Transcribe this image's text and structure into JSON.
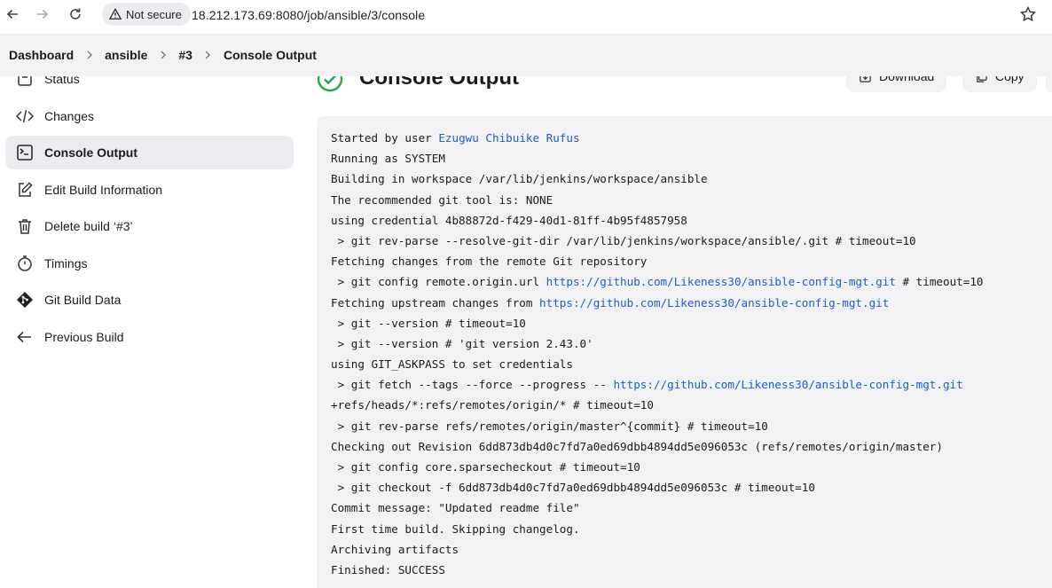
{
  "browser": {
    "security_label": "Not secure",
    "url": "18.212.173.69:8080/job/ansible/3/console"
  },
  "breadcrumb": {
    "items": [
      "Dashboard",
      "ansible",
      "#3",
      "Console Output"
    ]
  },
  "sidebar": {
    "items": [
      {
        "label": "Status",
        "icon": "status-icon"
      },
      {
        "label": "Changes",
        "icon": "code-icon"
      },
      {
        "label": "Console Output",
        "icon": "terminal-icon",
        "active": true
      },
      {
        "label": "Edit Build Information",
        "icon": "edit-icon"
      },
      {
        "label": "Delete build ‘#3’",
        "icon": "trash-icon"
      },
      {
        "label": "Timings",
        "icon": "stopwatch-icon"
      },
      {
        "label": "Git Build Data",
        "icon": "git-icon"
      },
      {
        "label": "Previous Build",
        "icon": "arrow-left-icon"
      }
    ]
  },
  "main": {
    "title": "Console Output",
    "download_label": "Download",
    "copy_label": "Copy",
    "status_color": "#1ea64b"
  },
  "console": {
    "lines": [
      {
        "pre": "Started by user ",
        "link": "Ezugwu Chibuike Rufus",
        "post": ""
      },
      {
        "pre": "Running as SYSTEM"
      },
      {
        "pre": "Building in workspace /var/lib/jenkins/workspace/ansible"
      },
      {
        "pre": "The recommended git tool is: NONE"
      },
      {
        "pre": "using credential 4b88872d-f429-40d1-81ff-4b95f4857958"
      },
      {
        "pre": " > git rev-parse --resolve-git-dir /var/lib/jenkins/workspace/ansible/.git # timeout=10"
      },
      {
        "pre": "Fetching changes from the remote Git repository"
      },
      {
        "pre": " > git config remote.origin.url ",
        "link": "https://github.com/Likeness30/ansible-config-mgt.git",
        "post": " # timeout=10"
      },
      {
        "pre": "Fetching upstream changes from ",
        "link": "https://github.com/Likeness30/ansible-config-mgt.git",
        "post": ""
      },
      {
        "pre": " > git --version # timeout=10"
      },
      {
        "pre": " > git --version # 'git version 2.43.0'"
      },
      {
        "pre": "using GIT_ASKPASS to set credentials"
      },
      {
        "pre": " > git fetch --tags --force --progress -- ",
        "link": "https://github.com/Likeness30/ansible-config-mgt.git",
        "post": ""
      },
      {
        "pre": "+refs/heads/*:refs/remotes/origin/* # timeout=10"
      },
      {
        "pre": " > git rev-parse refs/remotes/origin/master^{commit} # timeout=10"
      },
      {
        "pre": "Checking out Revision 6dd873db4d0c7fd7a0ed69dbb4894dd5e096053c (refs/remotes/origin/master)"
      },
      {
        "pre": " > git config core.sparsecheckout # timeout=10"
      },
      {
        "pre": " > git checkout -f 6dd873db4d0c7fd7a0ed69dbb4894dd5e096053c # timeout=10"
      },
      {
        "pre": "Commit message: \"Updated readme file\""
      },
      {
        "pre": "First time build. Skipping changelog."
      },
      {
        "pre": "Archiving artifacts"
      },
      {
        "pre": "Finished: SUCCESS"
      }
    ]
  }
}
